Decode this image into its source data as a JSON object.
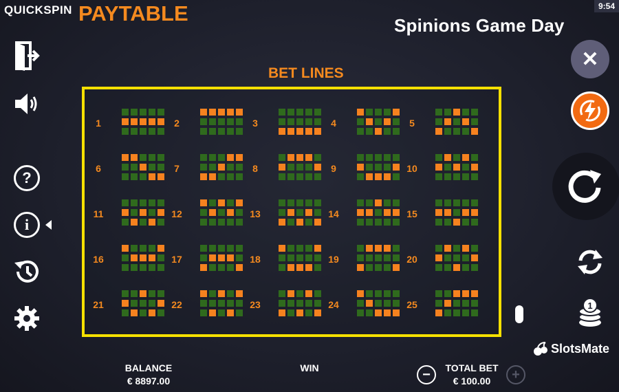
{
  "header": {
    "brand": "QUICKSPIN",
    "paytable_title": "PAYTABLE",
    "game_title": "Spinions Game Day",
    "clock": "9:54"
  },
  "section": {
    "title": "BET LINES"
  },
  "lines": [
    {
      "n": "1",
      "rows": [
        [
          0,
          1,
          2,
          3,
          4
        ],
        [
          0,
          1,
          2,
          3,
          4
        ],
        [
          0,
          1,
          2,
          3,
          4
        ]
      ],
      "path": [
        1,
        1,
        1,
        1,
        1
      ]
    },
    {
      "n": "2",
      "path": [
        0,
        0,
        0,
        0,
        0
      ]
    },
    {
      "n": "3",
      "path": [
        2,
        2,
        2,
        2,
        2
      ]
    },
    {
      "n": "4",
      "path": [
        0,
        1,
        2,
        1,
        0
      ]
    },
    {
      "n": "5",
      "path": [
        2,
        1,
        0,
        1,
        2
      ]
    },
    {
      "n": "6",
      "path": [
        0,
        0,
        1,
        2,
        2
      ]
    },
    {
      "n": "7",
      "path": [
        2,
        2,
        1,
        0,
        0
      ]
    },
    {
      "n": "8",
      "path": [
        1,
        0,
        0,
        0,
        1
      ]
    },
    {
      "n": "9",
      "path": [
        1,
        2,
        2,
        2,
        1
      ]
    },
    {
      "n": "10",
      "path": [
        1,
        0,
        1,
        0,
        1
      ]
    },
    {
      "n": "11",
      "path": [
        1,
        2,
        1,
        2,
        1
      ]
    },
    {
      "n": "12",
      "path": [
        0,
        1,
        0,
        1,
        0
      ]
    },
    {
      "n": "13",
      "path": [
        2,
        1,
        2,
        1,
        2
      ]
    },
    {
      "n": "14",
      "path": [
        1,
        1,
        0,
        1,
        1
      ]
    },
    {
      "n": "15",
      "path": [
        1,
        1,
        2,
        1,
        1
      ]
    },
    {
      "n": "16",
      "path": [
        0,
        1,
        1,
        1,
        0
      ]
    },
    {
      "n": "17",
      "path": [
        2,
        1,
        1,
        1,
        2
      ]
    },
    {
      "n": "18",
      "path": [
        0,
        2,
        2,
        2,
        0
      ]
    },
    {
      "n": "19",
      "path": [
        2,
        0,
        0,
        0,
        2
      ]
    },
    {
      "n": "20",
      "path": [
        1,
        0,
        2,
        0,
        1
      ]
    },
    {
      "n": "21",
      "path": [
        1,
        2,
        0,
        2,
        1
      ]
    },
    {
      "n": "22",
      "path": [
        0,
        2,
        0,
        2,
        0
      ]
    },
    {
      "n": "23",
      "path": [
        2,
        0,
        2,
        0,
        2
      ]
    },
    {
      "n": "24",
      "path": [
        0,
        1,
        2,
        2,
        2
      ]
    },
    {
      "n": "25",
      "path": [
        2,
        1,
        0,
        0,
        0
      ]
    }
  ],
  "footer": {
    "balance_label": "BALANCE",
    "balance_value": "€ 8897.00",
    "win_label": "WIN",
    "total_bet_label": "TOTAL BET",
    "total_bet_value": "€ 100.00",
    "minus": "−",
    "plus": "+"
  },
  "watermark": "SlotsMate",
  "colors": {
    "accent": "#f58a1f",
    "frame": "#f5e000",
    "cell_on": "#f6821f",
    "cell_off": "#2f6a1d"
  }
}
